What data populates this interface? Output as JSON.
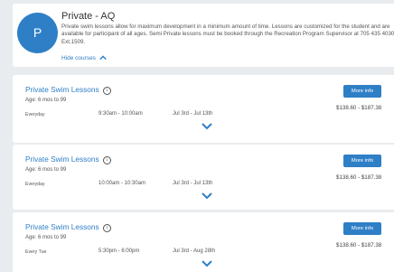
{
  "header": {
    "avatar_letter": "P",
    "title": "Private - AQ",
    "description": "Private swim lessons allow for maximum development in a minimum amount of time. Lessons are customized for the student and are available for participant of all ages. Semi Private lessons must be booked through the Recreation Program Supervisor at 705 435 4030 Ext.1509.",
    "toggle_label": "Hide courses"
  },
  "courses": [
    {
      "title": "Private Swim Lessons",
      "age": "Age: 6 mos to 99",
      "day": "Everyday",
      "time": "9:30am - 10:00am",
      "dates": "Jul 3rd - Jul 13th",
      "button": "More info",
      "price": "$138.60 - $187.38"
    },
    {
      "title": "Private Swim Lessons",
      "age": "Age: 6 mos to 99",
      "day": "Everyday",
      "time": "10:00am - 10:30am",
      "dates": "Jul 3rd - Jul 13th",
      "button": "More info",
      "price": "$138.60 - $187.38"
    },
    {
      "title": "Private Swim Lessons",
      "age": "Age: 6 mos to 99",
      "day": "Every Tue",
      "time": "5:30pm - 6:00pm",
      "dates": "Jul 3rd - Aug 28th",
      "button": "More info",
      "price": "$138.60 - $187.38"
    }
  ],
  "colors": {
    "accent": "#2e7fc6",
    "background": "#e9ecef",
    "card": "#ffffff"
  }
}
